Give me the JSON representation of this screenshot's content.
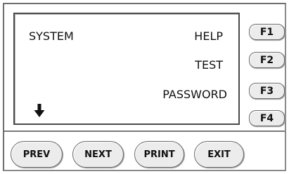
{
  "screen": {
    "system_label": "SYSTEM",
    "help_label": "HELP",
    "test_label": "TEST",
    "password_label": "PASSWORD",
    "scroll_icon": "arrow-down-icon"
  },
  "function_keys": [
    {
      "label": "F1"
    },
    {
      "label": "F2"
    },
    {
      "label": "F3"
    },
    {
      "label": "F4"
    }
  ],
  "nav_buttons": [
    {
      "label": "PREV"
    },
    {
      "label": "NEXT"
    },
    {
      "label": "PRINT"
    },
    {
      "label": "EXIT"
    }
  ]
}
